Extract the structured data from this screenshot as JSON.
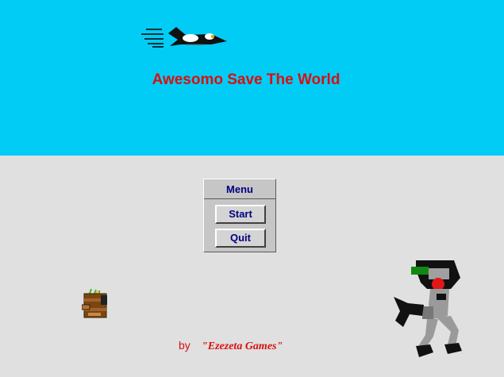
{
  "game": {
    "title": "Awesomo Save The World",
    "menu": {
      "header": "Menu",
      "start_label": "Start",
      "quit_label": "Quit"
    },
    "credit": {
      "by": "by",
      "author": "\"Ezezeta Games\""
    }
  },
  "colors": {
    "sky": "#00ccf5",
    "ground": "#e0e0e0",
    "title_text": "#d81010",
    "button_text": "#000080"
  },
  "icons": {
    "jet": "jet-sprite-icon",
    "crate": "treasure-crate-icon",
    "robot": "robot-enemy-icon"
  }
}
